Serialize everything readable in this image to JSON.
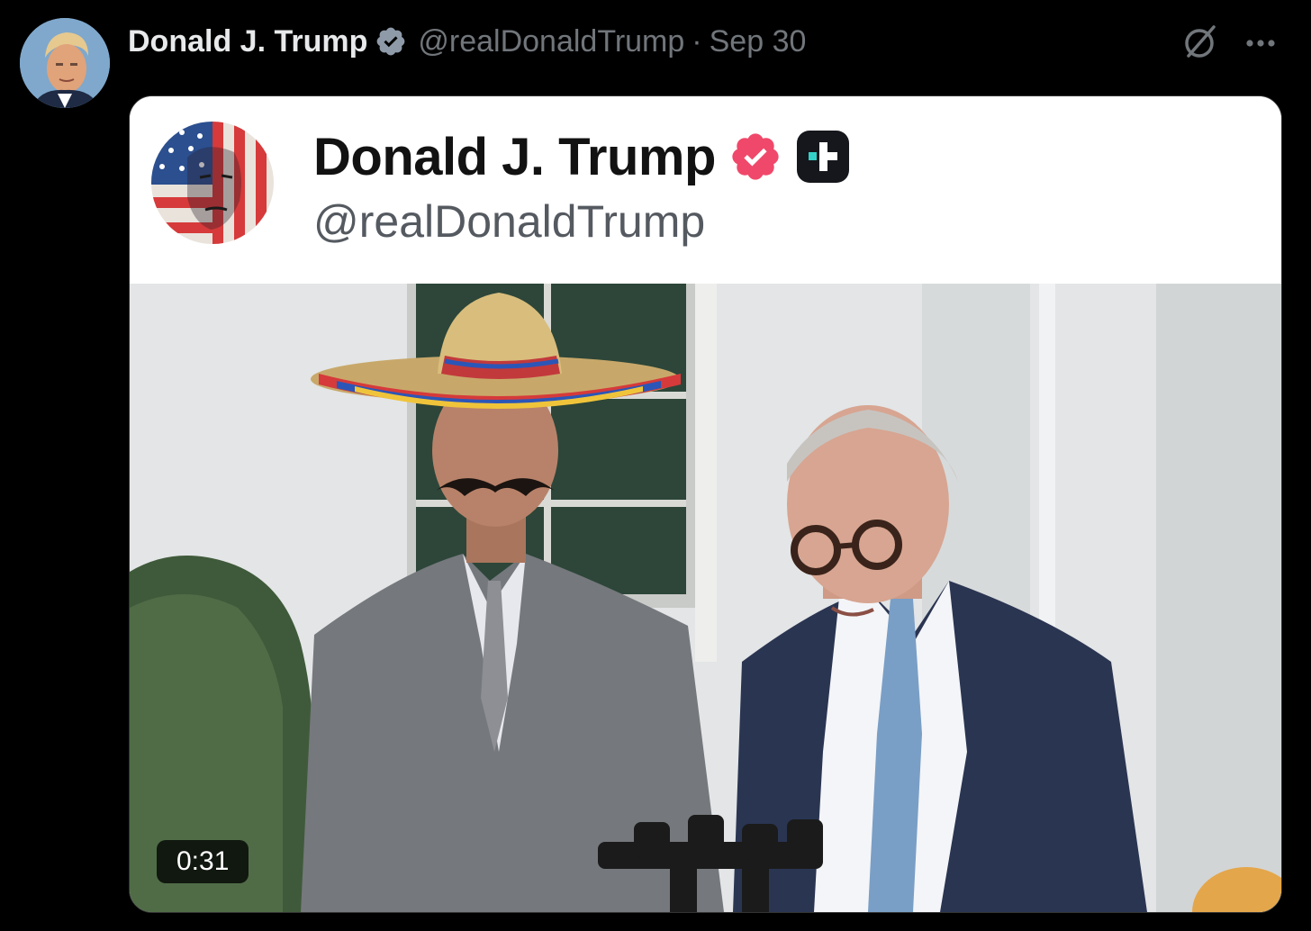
{
  "tweet": {
    "author_name": "Donald J. Trump",
    "handle": "@realDonaldTrump",
    "separator": "·",
    "timestamp": "Sep 30",
    "icons": {
      "verified": "verified-badge-icon",
      "grok": "grok-icon",
      "more": "more-options-icon"
    },
    "colors": {
      "background": "#000000",
      "name_text": "#e7e9ea",
      "muted_text": "#71767b",
      "verified_blue": "#1d9bf0"
    }
  },
  "embedded_post": {
    "author_name": "Donald J. Trump",
    "handle": "@realDonaldTrump",
    "icons": {
      "verified": "verified-badge-icon",
      "truth_social_plus": "truth-social-plus-icon"
    },
    "colors": {
      "verified_pink": "#f0486a",
      "name_text": "#121212",
      "handle_text": "#555a61"
    }
  },
  "video": {
    "duration": "0:31"
  }
}
